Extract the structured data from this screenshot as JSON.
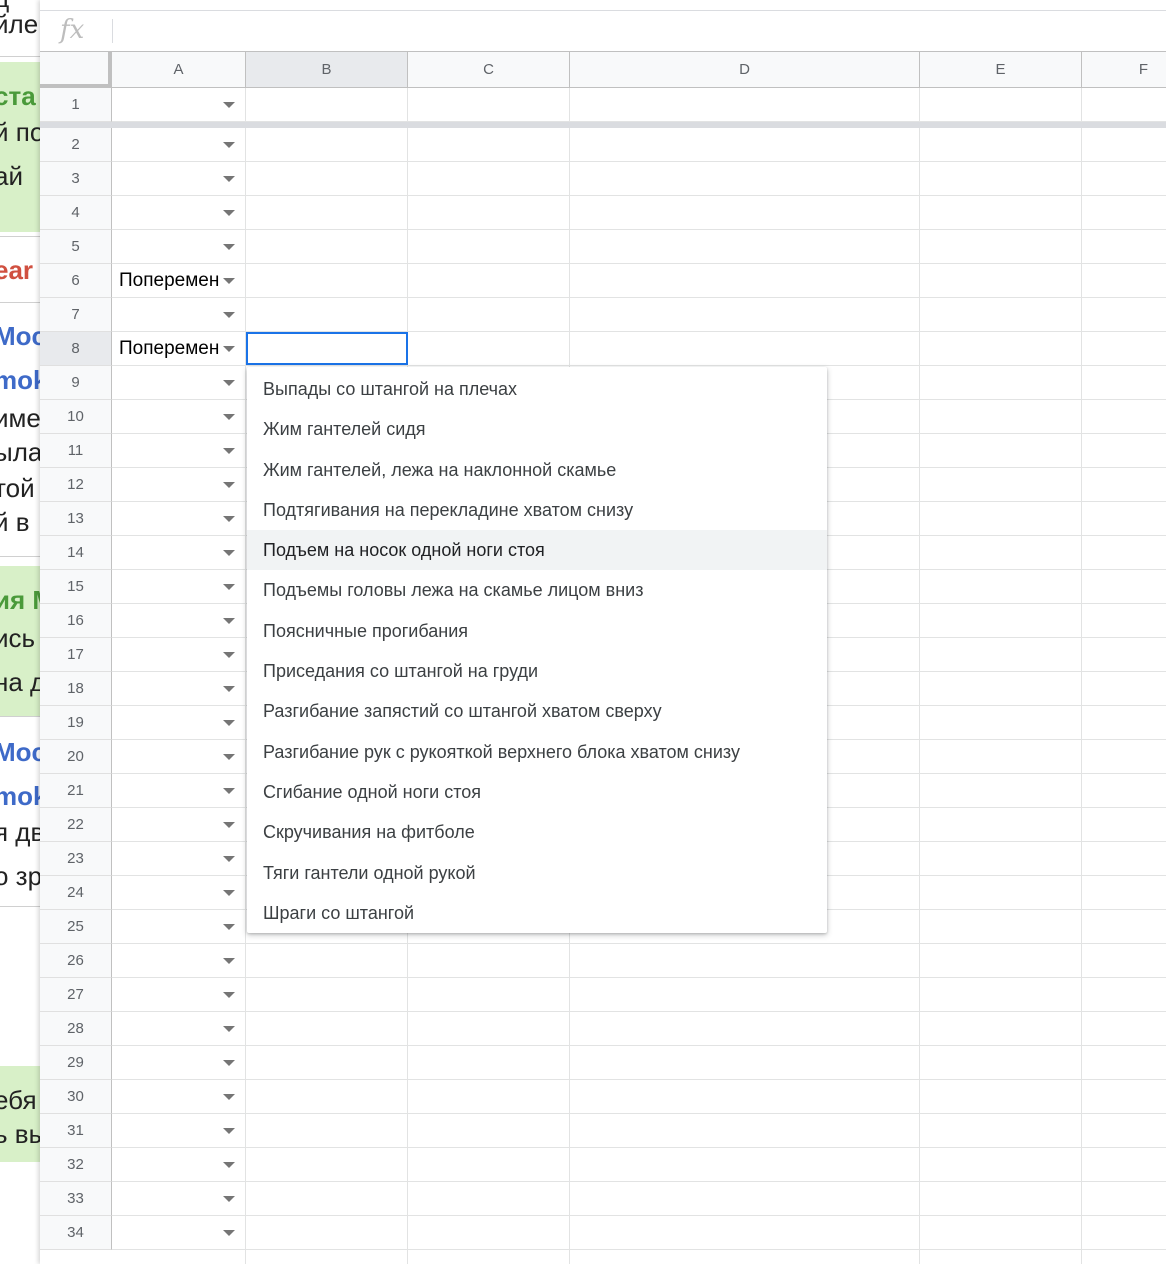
{
  "background_window": {
    "fragments": [
      {
        "text": "д",
        "color": "black"
      },
      {
        "text": "йле",
        "color": "black"
      },
      {
        "text": "ста",
        "color": "green"
      },
      {
        "text": "й по",
        "color": "black"
      },
      {
        "text": "ай",
        "color": "black"
      },
      {
        "text": "ear",
        "color": "red"
      },
      {
        "text": "Moc",
        "color": "blue"
      },
      {
        "text": "mok",
        "color": "blue"
      },
      {
        "text": "име",
        "color": "black"
      },
      {
        "text": "ыла",
        "color": "black"
      },
      {
        "text": "той",
        "color": "black"
      },
      {
        "text": "й в",
        "color": "black"
      },
      {
        "text": "ия М",
        "color": "green"
      },
      {
        "text": "ись",
        "color": "black"
      },
      {
        "text": "на д",
        "color": "black"
      },
      {
        "text": "Moc",
        "color": "blue"
      },
      {
        "text": "mok",
        "color": "blue"
      },
      {
        "text": "я дв",
        "color": "black"
      },
      {
        "text": "о зр",
        "color": "black"
      },
      {
        "text": "ебя",
        "color": "black"
      },
      {
        "text": "ь вы",
        "color": "black"
      }
    ]
  },
  "formula_bar": {
    "icon": "fx-icon",
    "value": ""
  },
  "columns": [
    "A",
    "B",
    "C",
    "D",
    "E",
    "F"
  ],
  "rows": [
    "1",
    "2",
    "3",
    "4",
    "5",
    "6",
    "7",
    "8",
    "9",
    "10",
    "11",
    "12",
    "13",
    "14",
    "15",
    "16",
    "17",
    "18",
    "19",
    "20",
    "21",
    "22",
    "23",
    "24",
    "25",
    "26",
    "27",
    "28",
    "29",
    "30",
    "31",
    "32",
    "33",
    "34"
  ],
  "cells_a": {
    "6": "Попеременные",
    "8": "Попеременные"
  },
  "active_cell": "B8",
  "dropdown": {
    "items": [
      "Выпады со штангой на плечах",
      "Жим гантелей сидя",
      "Жим гантелей, лежа на наклонной скамье",
      "Подтягивания на перекладине хватом снизу",
      "Подъем на носок одной ноги стоя",
      "Подъемы головы лежа на скамье лицом вниз",
      "Поясничные прогибания",
      "Приседания со штангой на груди",
      "Разгибание запястий со штангой хватом сверху",
      "Разгибание рук с рукояткой верхнего блока хватом снизу",
      "Сгибание одной ноги стоя",
      "Скручивания на фитболе",
      "Тяги гантели одной рукой",
      "Шраги со штангой"
    ],
    "hovered_index": 4
  },
  "colors": {
    "selection_border": "#1a73e8",
    "header_bg": "#f8f9fa",
    "gridline": "#e2e3e3"
  }
}
